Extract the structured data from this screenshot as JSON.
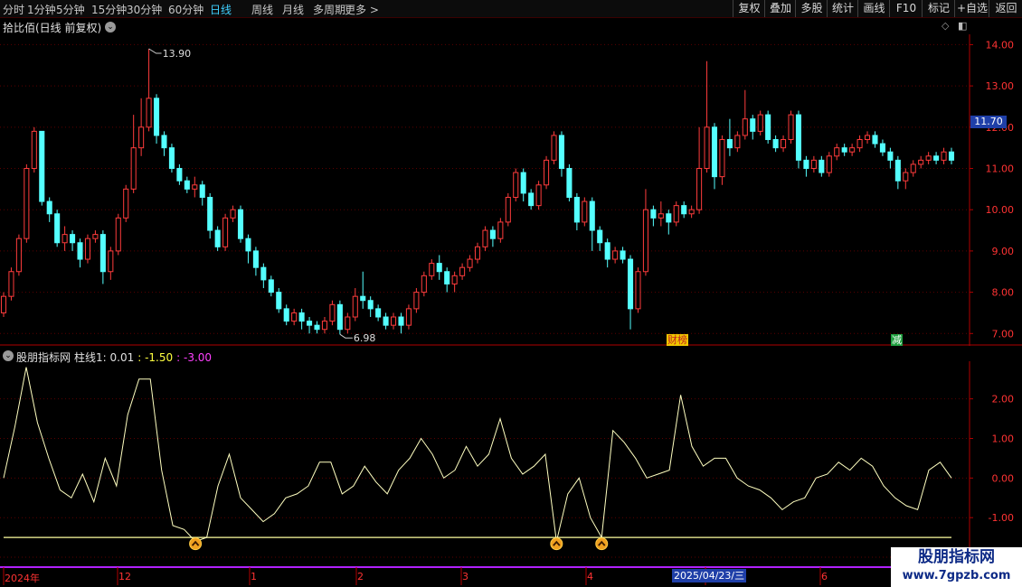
{
  "toolbar": {
    "periods": [
      "分时",
      "1分钟",
      "5分钟",
      "15分钟",
      "30分钟",
      "60分钟",
      "日线",
      "周线",
      "月线",
      "多周期",
      "更多 >"
    ],
    "active_period": "日线",
    "buttons": [
      "复权",
      "叠加",
      "多股",
      "统计",
      "画线",
      "F10",
      "标记",
      "+自选",
      "返回"
    ]
  },
  "chart": {
    "title": "拾比佰(日线 前复权)",
    "price_axis": [
      "14.00",
      "13.00",
      "12.00",
      "11.00",
      "10.00",
      "9.00",
      "8.00",
      "7.00"
    ],
    "current_price": "11.70",
    "high_label": "13.90",
    "low_label": "6.98",
    "events": [
      {
        "text": "财榜",
        "bg": "#f0c800",
        "color": "#c02020"
      },
      {
        "text": "减",
        "bg": "#1f9f3f",
        "color": "#ffffff"
      }
    ],
    "colors": {
      "up": "#ff3c3c",
      "down": "#54ffff",
      "grid": "#5a0000",
      "axis": "#b00000"
    }
  },
  "indicator": {
    "name": "股朋指标网",
    "series_label": "柱线1: 0.01",
    "value2": ": -1.50",
    "value3": ": -3.00",
    "axis": [
      "2.00",
      "1.00",
      "0.00",
      "-1.00",
      "-2.00"
    ],
    "colors": {
      "line": "#ffffc0",
      "value2": "#ffff40",
      "value3": "#ff40ff"
    }
  },
  "date_axis": {
    "labels": [
      "2024年",
      "12",
      "1",
      "2",
      "3",
      "4",
      "5",
      "6"
    ],
    "cursor": "2025/04/23/三"
  },
  "watermark": {
    "name": "股朋指标网",
    "url": "www.7gpzb.com"
  },
  "chart_data": {
    "type": "candlestick",
    "y_range": [
      6.7,
      14.25
    ],
    "candles": [
      [
        7.5,
        7.9,
        7.4,
        8.0
      ],
      [
        7.9,
        8.5,
        7.8,
        8.6
      ],
      [
        8.5,
        9.3,
        8.4,
        9.4
      ],
      [
        9.3,
        11.0,
        9.2,
        11.1
      ],
      [
        11.0,
        11.9,
        10.9,
        12.0
      ],
      [
        11.9,
        10.2,
        10.1,
        11.9
      ],
      [
        10.2,
        9.9,
        9.7,
        10.3
      ],
      [
        9.9,
        9.2,
        9.1,
        10.0
      ],
      [
        9.2,
        9.4,
        9.0,
        9.6
      ],
      [
        9.4,
        9.2,
        9.0,
        9.5
      ],
      [
        9.2,
        8.8,
        8.6,
        9.3
      ],
      [
        8.8,
        9.3,
        8.7,
        9.4
      ],
      [
        9.3,
        9.4,
        9.2,
        9.5
      ],
      [
        9.4,
        8.5,
        8.2,
        9.5
      ],
      [
        8.5,
        9.0,
        8.3,
        9.1
      ],
      [
        9.0,
        9.8,
        8.9,
        9.9
      ],
      [
        9.8,
        10.5,
        9.7,
        10.6
      ],
      [
        10.5,
        11.5,
        10.4,
        12.3
      ],
      [
        11.5,
        12.0,
        11.3,
        12.7
      ],
      [
        12.0,
        12.7,
        11.9,
        13.9
      ],
      [
        12.7,
        11.8,
        11.6,
        12.8
      ],
      [
        11.8,
        11.5,
        11.3,
        11.9
      ],
      [
        11.5,
        11.0,
        10.9,
        11.6
      ],
      [
        11.0,
        10.7,
        10.6,
        11.1
      ],
      [
        10.7,
        10.5,
        10.4,
        10.8
      ],
      [
        10.5,
        10.6,
        10.3,
        10.8
      ],
      [
        10.6,
        10.3,
        10.1,
        10.7
      ],
      [
        10.3,
        9.5,
        9.3,
        10.4
      ],
      [
        9.5,
        9.1,
        9.0,
        9.6
      ],
      [
        9.1,
        9.8,
        9.0,
        9.9
      ],
      [
        9.8,
        10.0,
        9.7,
        10.1
      ],
      [
        10.0,
        9.3,
        9.2,
        10.1
      ],
      [
        9.3,
        9.0,
        8.7,
        9.4
      ],
      [
        9.0,
        8.6,
        8.4,
        9.1
      ],
      [
        8.6,
        8.3,
        8.1,
        8.7
      ],
      [
        8.3,
        8.0,
        7.9,
        8.4
      ],
      [
        8.0,
        7.6,
        7.5,
        8.1
      ],
      [
        7.6,
        7.3,
        7.2,
        7.7
      ],
      [
        7.3,
        7.5,
        7.2,
        7.6
      ],
      [
        7.5,
        7.3,
        7.1,
        7.6
      ],
      [
        7.3,
        7.2,
        7.0,
        7.4
      ],
      [
        7.2,
        7.1,
        7.0,
        7.3
      ],
      [
        7.1,
        7.3,
        7.0,
        7.4
      ],
      [
        7.3,
        7.7,
        7.2,
        7.8
      ],
      [
        7.7,
        7.1,
        6.98,
        7.8
      ],
      [
        7.1,
        7.4,
        7.0,
        7.5
      ],
      [
        7.4,
        7.9,
        7.3,
        8.1
      ],
      [
        7.9,
        7.8,
        7.6,
        8.5
      ],
      [
        7.8,
        7.6,
        7.4,
        7.9
      ],
      [
        7.6,
        7.4,
        7.3,
        7.7
      ],
      [
        7.4,
        7.2,
        7.1,
        7.5
      ],
      [
        7.2,
        7.4,
        7.1,
        7.5
      ],
      [
        7.4,
        7.2,
        7.0,
        7.5
      ],
      [
        7.2,
        7.6,
        7.1,
        7.7
      ],
      [
        7.6,
        8.0,
        7.5,
        8.1
      ],
      [
        8.0,
        8.4,
        7.9,
        8.5
      ],
      [
        8.4,
        8.7,
        8.3,
        8.8
      ],
      [
        8.7,
        8.5,
        8.3,
        8.9
      ],
      [
        8.5,
        8.2,
        8.0,
        8.6
      ],
      [
        8.2,
        8.4,
        8.0,
        8.5
      ],
      [
        8.4,
        8.6,
        8.3,
        8.7
      ],
      [
        8.6,
        8.8,
        8.5,
        8.9
      ],
      [
        8.8,
        9.1,
        8.7,
        9.2
      ],
      [
        9.1,
        9.5,
        9.0,
        9.6
      ],
      [
        9.5,
        9.3,
        9.1,
        9.6
      ],
      [
        9.3,
        9.7,
        9.2,
        9.8
      ],
      [
        9.7,
        10.3,
        9.6,
        10.4
      ],
      [
        10.3,
        10.9,
        10.2,
        11.0
      ],
      [
        10.9,
        10.4,
        10.2,
        11.0
      ],
      [
        10.4,
        10.1,
        10.0,
        10.5
      ],
      [
        10.1,
        10.6,
        10.0,
        10.7
      ],
      [
        10.6,
        11.2,
        10.5,
        11.3
      ],
      [
        11.2,
        11.8,
        11.1,
        11.9
      ],
      [
        11.8,
        11.0,
        10.8,
        11.9
      ],
      [
        11.0,
        10.3,
        10.2,
        11.1
      ],
      [
        10.3,
        9.7,
        9.5,
        10.4
      ],
      [
        9.7,
        10.2,
        9.6,
        10.3
      ],
      [
        10.2,
        9.5,
        9.0,
        10.3
      ],
      [
        9.5,
        9.2,
        9.0,
        9.6
      ],
      [
        9.2,
        8.8,
        8.6,
        9.3
      ],
      [
        8.8,
        9.0,
        8.7,
        9.1
      ],
      [
        9.0,
        8.8,
        8.7,
        9.1
      ],
      [
        8.8,
        7.6,
        7.1,
        8.9
      ],
      [
        7.6,
        8.5,
        7.5,
        8.6
      ],
      [
        8.5,
        10.0,
        8.4,
        10.5
      ],
      [
        10.0,
        9.8,
        9.6,
        10.1
      ],
      [
        9.8,
        9.9,
        9.6,
        10.2
      ],
      [
        9.9,
        9.7,
        9.4,
        10.0
      ],
      [
        9.7,
        10.1,
        9.6,
        10.2
      ],
      [
        10.1,
        9.9,
        9.8,
        10.2
      ],
      [
        9.9,
        10.0,
        9.8,
        10.1
      ],
      [
        10.0,
        11.0,
        9.9,
        12.0
      ],
      [
        11.0,
        12.0,
        10.9,
        13.6
      ],
      [
        12.0,
        10.8,
        10.5,
        12.1
      ],
      [
        10.8,
        11.7,
        10.6,
        11.8
      ],
      [
        11.7,
        11.5,
        11.3,
        12.2
      ],
      [
        11.5,
        11.8,
        11.4,
        11.9
      ],
      [
        11.8,
        12.2,
        11.7,
        12.9
      ],
      [
        12.2,
        11.9,
        11.7,
        12.3
      ],
      [
        11.9,
        12.3,
        11.8,
        12.4
      ],
      [
        12.3,
        11.7,
        11.6,
        12.4
      ],
      [
        11.7,
        11.5,
        11.4,
        11.8
      ],
      [
        11.5,
        11.7,
        11.4,
        11.8
      ],
      [
        11.7,
        12.3,
        11.6,
        12.4
      ],
      [
        12.3,
        11.2,
        11.0,
        12.4
      ],
      [
        11.2,
        11.0,
        10.8,
        11.3
      ],
      [
        11.0,
        11.2,
        10.9,
        11.3
      ],
      [
        11.2,
        10.9,
        10.8,
        11.3
      ],
      [
        10.9,
        11.3,
        10.8,
        11.4
      ],
      [
        11.3,
        11.5,
        11.2,
        11.6
      ],
      [
        11.5,
        11.4,
        11.3,
        11.6
      ],
      [
        11.4,
        11.5,
        11.3,
        11.6
      ],
      [
        11.5,
        11.7,
        11.4,
        11.8
      ],
      [
        11.7,
        11.8,
        11.6,
        11.9
      ],
      [
        11.8,
        11.6,
        11.5,
        11.9
      ],
      [
        11.6,
        11.4,
        11.3,
        11.7
      ],
      [
        11.4,
        11.2,
        11.0,
        11.5
      ],
      [
        11.2,
        10.7,
        10.5,
        11.3
      ],
      [
        10.7,
        10.9,
        10.5,
        11.0
      ],
      [
        10.9,
        11.1,
        10.8,
        11.2
      ],
      [
        11.1,
        11.2,
        11.0,
        11.3
      ],
      [
        11.2,
        11.3,
        11.1,
        11.4
      ],
      [
        11.3,
        11.2,
        11.1,
        11.4
      ],
      [
        11.2,
        11.4,
        11.1,
        11.5
      ],
      [
        11.4,
        11.2,
        11.1,
        11.5
      ]
    ],
    "indicator_y_range": [
      -2.25,
      2.95
    ],
    "indicator_values": [
      0.0,
      1.3,
      2.8,
      1.4,
      0.5,
      -0.3,
      -0.5,
      0.1,
      -0.6,
      0.5,
      -0.2,
      1.6,
      2.5,
      2.5,
      0.2,
      -1.2,
      -1.3,
      -1.6,
      -1.5,
      -0.2,
      0.6,
      -0.5,
      -0.8,
      -1.1,
      -0.9,
      -0.5,
      -0.4,
      -0.2,
      0.4,
      0.4,
      -0.4,
      -0.2,
      0.3,
      -0.1,
      -0.4,
      0.2,
      0.5,
      1.0,
      0.6,
      0.0,
      0.2,
      0.8,
      0.3,
      0.6,
      1.5,
      0.5,
      0.1,
      0.3,
      0.6,
      -1.6,
      -0.4,
      0.0,
      -1.0,
      -1.5,
      1.2,
      0.9,
      0.5,
      0.0,
      0.1,
      0.2,
      2.1,
      0.8,
      0.3,
      0.5,
      0.5,
      0.0,
      -0.2,
      -0.3,
      -0.5,
      -0.8,
      -0.6,
      -0.5,
      0.0,
      0.1,
      0.4,
      0.2,
      0.5,
      0.3,
      -0.2,
      -0.5,
      -0.7,
      -0.8,
      0.2,
      0.4,
      0.0
    ],
    "threshold": -1.5,
    "signal_indices": [
      17,
      49,
      53
    ]
  }
}
